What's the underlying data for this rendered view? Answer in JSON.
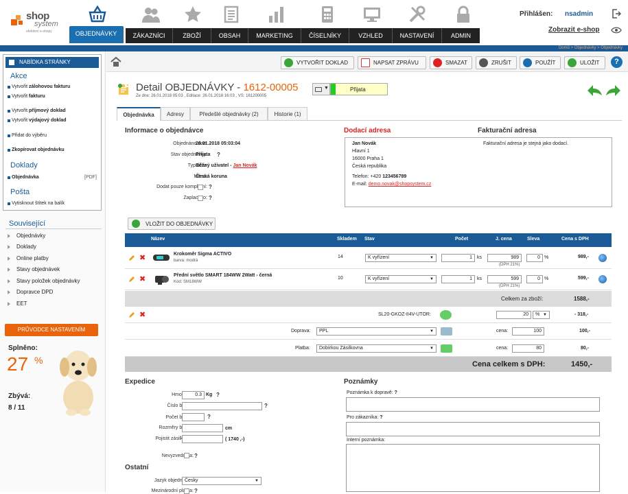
{
  "header": {
    "logo_shop": "shop",
    "logo_system": "system",
    "logo_tagline": "efektivní e-shopy",
    "nav_tabs": [
      "OBJEDNÁVKY",
      "ZÁKAZNÍCI",
      "ZBOŽÍ",
      "OBSAH",
      "MARKETING",
      "ČÍSELNÍKY",
      "VZHLED",
      "NASTAVENÍ",
      "ADMIN"
    ],
    "login_label": "Přihlášen:",
    "login_user": "nsadmin",
    "show_eshop": "Zobrazit e-shop",
    "breadcrumb": "Domů > Objednávky > Objednávky"
  },
  "sidebar": {
    "menu_title": "NABÍDKA STRÁNKY",
    "section_akce": "Akce",
    "akce": [
      {
        "pre": "Vytvořit ",
        "bold": "zálohovou fakturu"
      },
      {
        "pre": "Vytvořit ",
        "bold": "fakturu"
      },
      {
        "pre": "Vytvořit ",
        "bold": "příjmový doklad"
      },
      {
        "pre": "Vytvořit ",
        "bold": "výdajový doklad"
      },
      {
        "pre": "Přidat do výběru",
        "bold": ""
      },
      {
        "pre": "",
        "bold": "Zkopírovat objednávku"
      }
    ],
    "section_doklady": "Doklady",
    "doklad_item": "Objednávka",
    "doklad_pdf": "[PDF]",
    "section_posta": "Pošta",
    "posta_item": "Vytisknout štítek na balík",
    "related_title": "Související",
    "related": [
      "Objednávky",
      "Doklady",
      "Online platby",
      "Stavy objednávek",
      "Stavy položek objednávky",
      "Dopravce DPD",
      "EET"
    ],
    "guide_button": "PRŮVODCE NASTAVENÍM",
    "done_label": "Splněno:",
    "done_value": "27",
    "done_unit": "%",
    "remaining_label": "Zbývá:",
    "remaining_value": "8 / 11"
  },
  "toolbar": {
    "create_doc": "VYTVOŘIT DOKLAD",
    "write_msg": "NAPSAT ZPRÁVU",
    "delete": "SMAZAT",
    "cancel": "ZRUŠIT",
    "apply": "POUŽÍT",
    "save": "ULOŽIT",
    "help": "?"
  },
  "detail": {
    "title_prefix": "Detail OBJEDNÁVKY - ",
    "order_no": "1612-00005",
    "subtitle": "Ze dne: 26.01.2018 05:03 , Editace: 26.01.2018 16:03 , VS: 161200005",
    "status": "Přijata",
    "status_color": "#22cc22",
    "tabs": [
      "Objednávka",
      "Adresy",
      "Předešlé objednávky (2)",
      "Historie (1)"
    ]
  },
  "order_info": {
    "heading": "Informace o objednávce",
    "fields": [
      {
        "label": "Objednáno dne:",
        "value": "26.01.2018 05:03:04"
      },
      {
        "label": "Stav objednávky:",
        "value": "Přijata"
      },
      {
        "label": "Typ účtu:",
        "value": "Běžný uživatel - ",
        "link": "Jan Novák"
      },
      {
        "label": "Měna:",
        "value": "Česká koruna"
      },
      {
        "label": "Dodat pouze kompletní:",
        "value": ""
      },
      {
        "label": "Zaplaceno:",
        "value": ""
      }
    ]
  },
  "delivery": {
    "heading": "Dodací adresa",
    "name": "Jan Novák",
    "street": "Hlavní 1",
    "city": "16000 Praha 1",
    "country": "Česká republika",
    "phone_label": "Telefon:",
    "phone_prefix": "+420",
    "phone": "123456789",
    "email_label": "E-mail:",
    "email": "demo.novak@shopsystem.cz"
  },
  "billing": {
    "heading": "Fakturační adresa",
    "note": "Fakturační adresa je stejná jako dodací."
  },
  "items_table": {
    "add_button": "VLOŽIT DO OBJEDNÁVKY",
    "headers": [
      "Název",
      "Skladem",
      "Stav",
      "Počet",
      "J. cena",
      "Sleva",
      "Cena s DPH"
    ],
    "rows": [
      {
        "name": "Krokoměr Sigma ACTIVO",
        "sub": "barva: modrá",
        "stock": "14",
        "state": "K vyřízení",
        "qty": "1",
        "unit": "ks",
        "price": "989",
        "vat": "(DPH 21%)",
        "disc": "0",
        "pct": "%",
        "total": "989,-"
      },
      {
        "name": "Přední světlo SMART 184WW 2Watt - černá",
        "sub": "Kód: SM18WW",
        "stock": "10",
        "state": "K vyřízení",
        "qty": "1",
        "unit": "ks",
        "price": "599",
        "vat": "(DPH 21%)",
        "disc": "0",
        "pct": "%",
        "total": "599,-"
      }
    ],
    "subtotal_label": "Celkem za zboží:",
    "subtotal": "1588,-",
    "coupon_code": "SL20-GKOZ-II4V-UTOR:",
    "coupon_value": "20",
    "coupon_unit": "%",
    "coupon_total": "- 318,-",
    "shipping_label": "Doprava:",
    "shipping": "PPL",
    "shipping_price_label": "cena:",
    "shipping_price": "100",
    "shipping_total": "100,-",
    "payment_label": "Platba:",
    "payment": "Dobírkou Zásilkovna",
    "payment_price_label": "cena:",
    "payment_price": "80",
    "payment_total": "80,-",
    "grand_label": "Cena celkem s DPH:",
    "grand_total": "1450,-"
  },
  "expedice": {
    "heading": "Expedice",
    "weight_label": "Hmotnost:",
    "weight": "0.3",
    "weight_unit": "Kg",
    "parcel_label": "Číslo balíku:",
    "count_label": "Počet balíků:",
    "dims_label": "Rozměry balíku:",
    "dims_unit": "cm",
    "insure_label": "Pojistit zásilku na:",
    "insure_hint": "( 1740 ,-)",
    "unreturned_label": "Nevyzvednuta:"
  },
  "ostatni": {
    "heading": "Ostatní",
    "lang_label": "Jazyk objednávky:",
    "lang": "Česky",
    "intl_label": "Mezinárodní platba:"
  },
  "notes": {
    "heading": "Poznámky",
    "to_carrier": "Poznámka k dopravě:",
    "to_customer": "Pro zákazníka:",
    "internal": "Interní poznámka:"
  }
}
